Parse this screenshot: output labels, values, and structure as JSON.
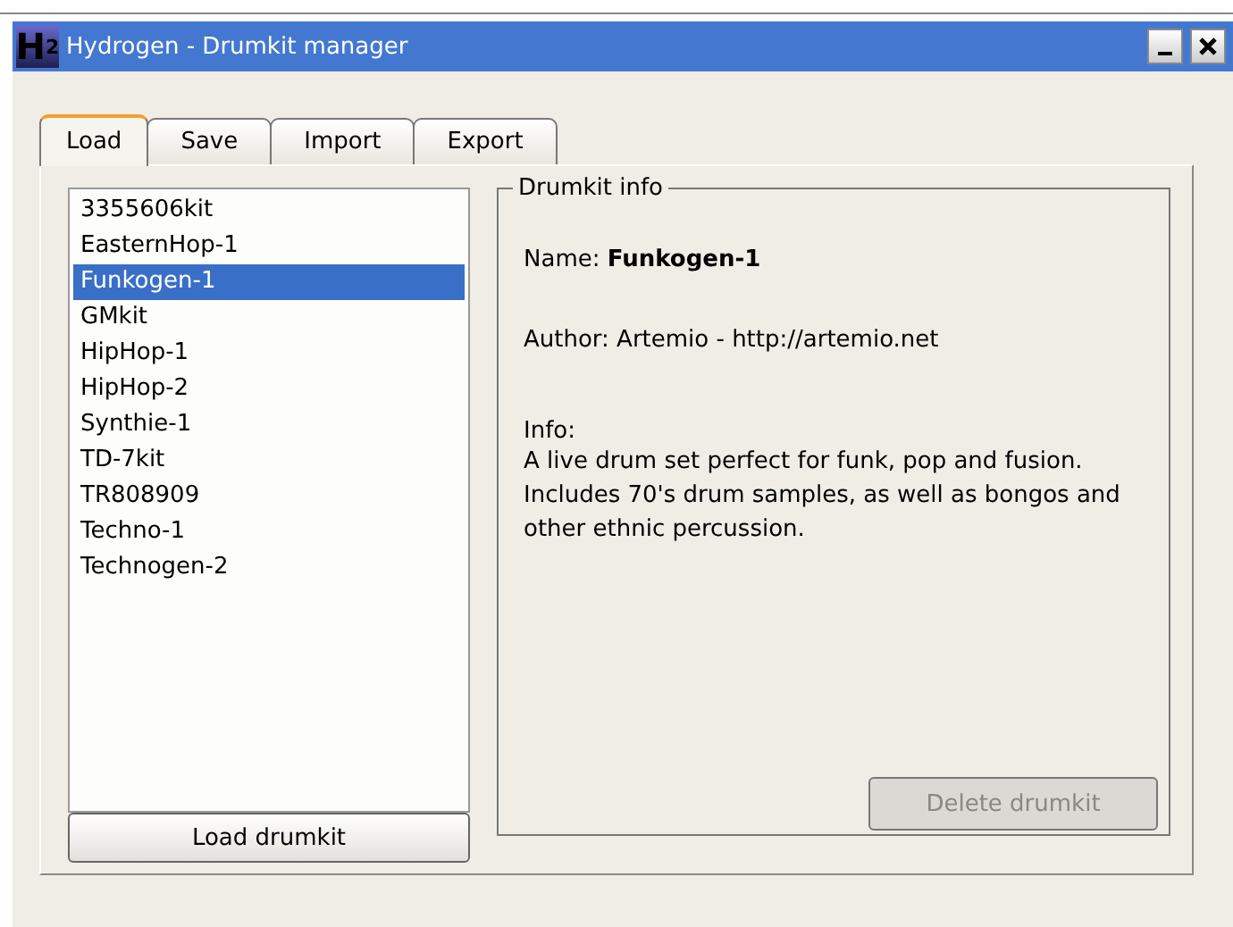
{
  "window": {
    "title": "Hydrogen - Drumkit manager",
    "logo": "H",
    "logo_sub": "2"
  },
  "tabs": [
    {
      "label": "Load",
      "selected": true
    },
    {
      "label": "Save",
      "selected": false
    },
    {
      "label": "Import",
      "selected": false
    },
    {
      "label": "Export",
      "selected": false
    }
  ],
  "drumkits": [
    {
      "label": "3355606kit",
      "selected": false
    },
    {
      "label": "EasternHop-1",
      "selected": false
    },
    {
      "label": "Funkogen-1",
      "selected": true
    },
    {
      "label": "GMkit",
      "selected": false
    },
    {
      "label": "HipHop-1",
      "selected": false
    },
    {
      "label": "HipHop-2",
      "selected": false
    },
    {
      "label": "Synthie-1",
      "selected": false
    },
    {
      "label": "TD-7kit",
      "selected": false
    },
    {
      "label": "TR808909",
      "selected": false
    },
    {
      "label": "Techno-1",
      "selected": false
    },
    {
      "label": "Technogen-2",
      "selected": false
    }
  ],
  "load_button": {
    "label": "Load drumkit",
    "disabled": false
  },
  "info": {
    "title": "Drumkit info",
    "name": "Name: **Funkogen-1**",
    "author": "Author: Artemio - http://artemio.net",
    "info_label": "Info:",
    "description": "A live drum set perfect for funk, pop and fusion. Includes 70's drum samples, as well as bongos and other ethnic percussion."
  },
  "delete_button": {
    "label": "Delete drumkit",
    "disabled": true
  }
}
